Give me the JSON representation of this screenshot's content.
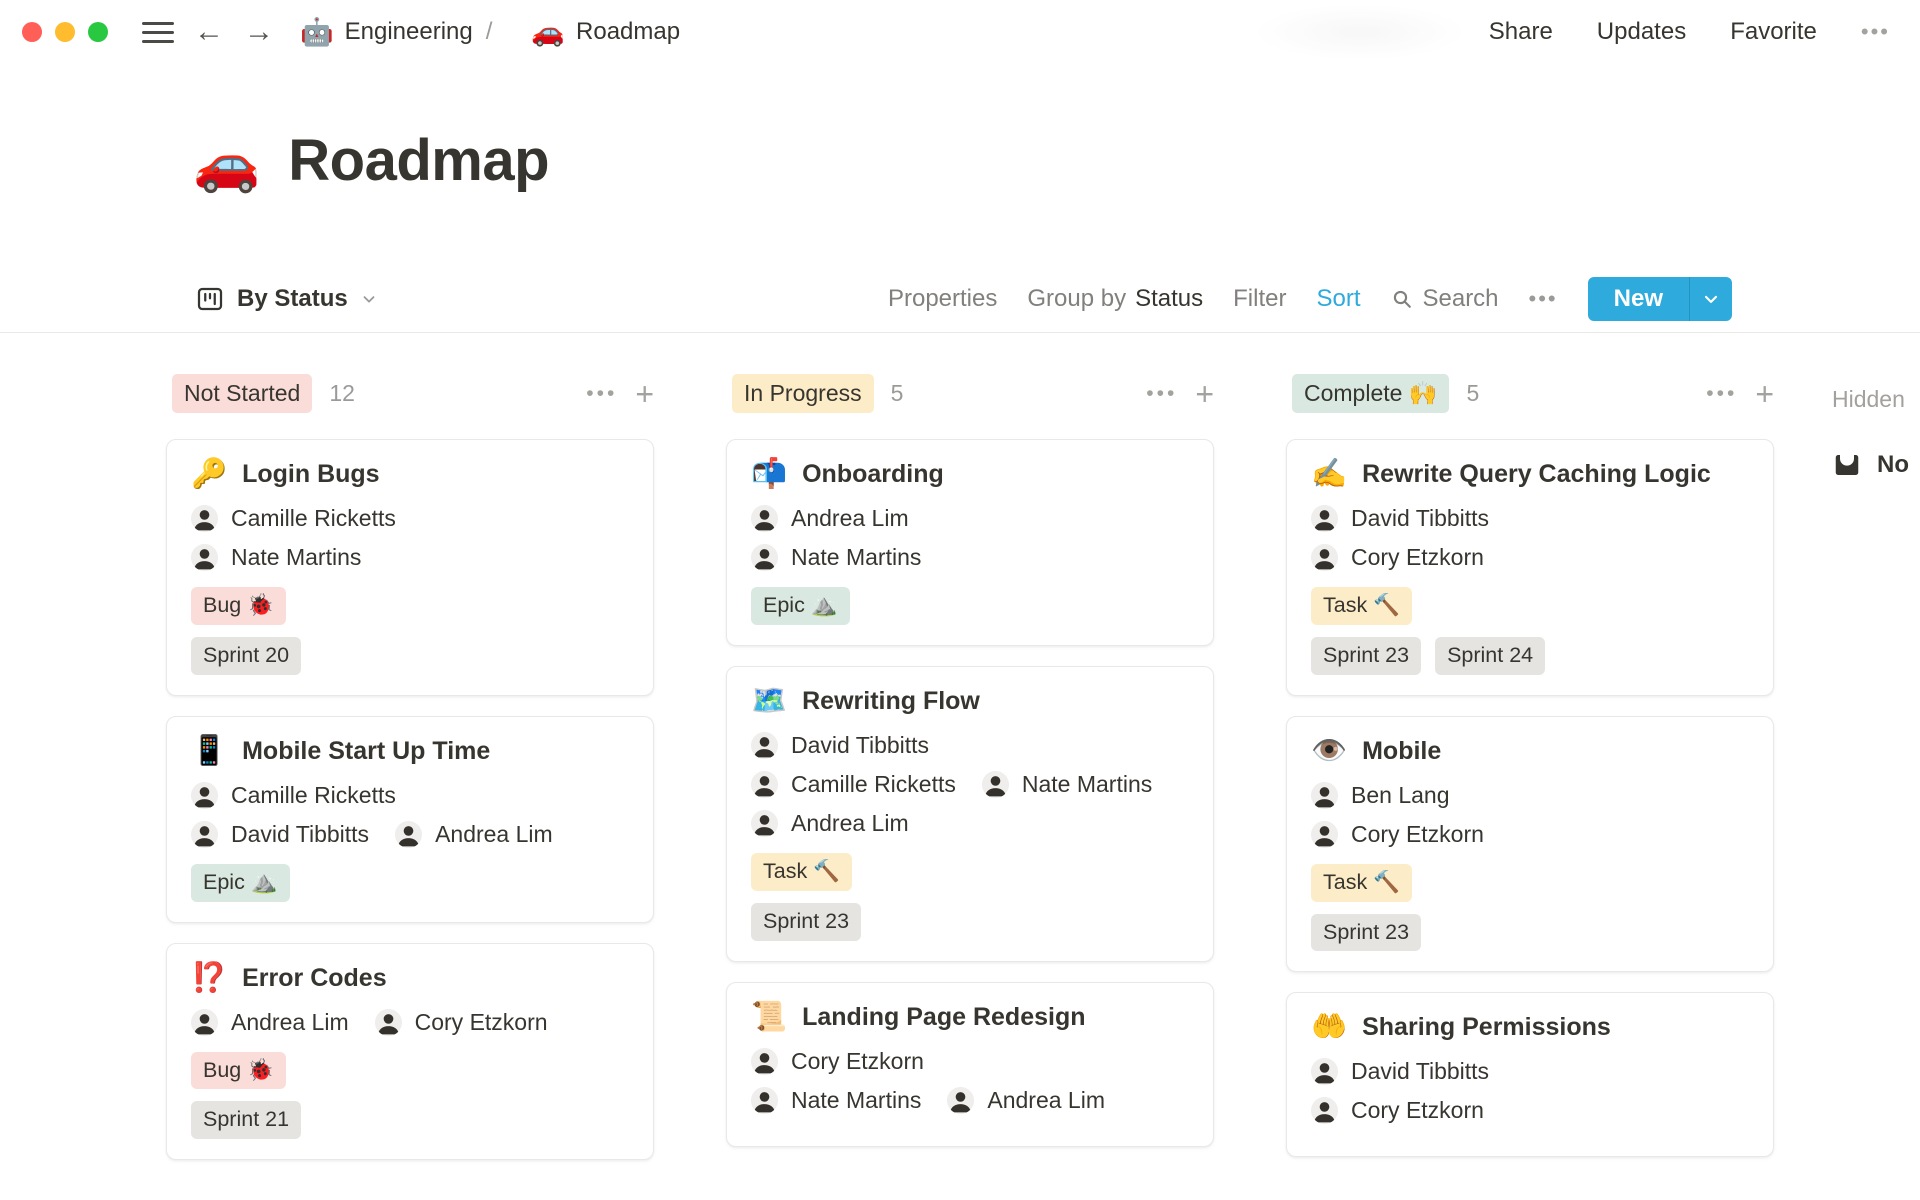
{
  "titlebar": {
    "back_icon": "←",
    "forward_icon": "→",
    "breadcrumb": {
      "separator": "/",
      "items": [
        {
          "icon": "🤖",
          "label": "Engineering"
        },
        {
          "icon": "🚗",
          "label": "Roadmap"
        }
      ]
    },
    "actions": [
      {
        "label": "Share"
      },
      {
        "label": "Updates"
      },
      {
        "label": "Favorite"
      },
      {
        "label": "•••"
      }
    ]
  },
  "page": {
    "icon": "🚗",
    "title": "Roadmap"
  },
  "toolbar": {
    "view_label": "By Status",
    "properties_label": "Properties",
    "group_by_label": "Group by",
    "group_by_value": "Status",
    "filter_label": "Filter",
    "sort_label": "Sort",
    "search_label": "Search",
    "more_label": "•••",
    "new_label": "New"
  },
  "colors": {
    "accent_blue": "#2EAADC",
    "pink": "#FADCD9",
    "yellow": "#FDECC8",
    "green": "#D9E8E0",
    "gray": "#E5E4E1",
    "traffic_red": "#FF5F57",
    "traffic_yellow": "#FEBC2E",
    "traffic_green": "#28C840"
  },
  "board": {
    "column_more": "•••",
    "column_add": "+",
    "hidden_label": "Hidden",
    "hidden_group": {
      "label": "No"
    },
    "columns": [
      {
        "name": "Not Started",
        "count": "12",
        "badge_color": "pink",
        "cards": [
          {
            "icon": "🔑",
            "icon_name": "key-icon",
            "title": "Login Bugs",
            "people": [
              [
                "Camille Ricketts"
              ],
              [
                "Nate Martins"
              ]
            ],
            "tag_rows": [
              [
                {
                  "label": "Bug 🐞",
                  "color": "pink"
                }
              ],
              [
                {
                  "label": "Sprint 20",
                  "color": "gray"
                }
              ]
            ]
          },
          {
            "icon": "📱",
            "icon_name": "mobile-phone-icon",
            "title": "Mobile Start Up Time",
            "people": [
              [
                "Camille Ricketts"
              ],
              [
                "David Tibbitts",
                "Andrea Lim"
              ]
            ],
            "tag_rows": [
              [
                {
                  "label": "Epic ⛰️",
                  "color": "green"
                }
              ]
            ]
          },
          {
            "icon": "⁉️",
            "icon_name": "exclamation-question-icon",
            "title": "Error Codes",
            "people": [
              [
                "Andrea Lim",
                "Cory Etzkorn"
              ]
            ],
            "tag_rows": [
              [
                {
                  "label": "Bug 🐞",
                  "color": "pink"
                }
              ],
              [
                {
                  "label": "Sprint 21",
                  "color": "gray"
                }
              ]
            ]
          }
        ]
      },
      {
        "name": "In Progress",
        "count": "5",
        "badge_color": "yellow",
        "cards": [
          {
            "icon": "📬",
            "icon_name": "mailbox-icon",
            "title": "Onboarding",
            "people": [
              [
                "Andrea Lim"
              ],
              [
                "Nate Martins"
              ]
            ],
            "tag_rows": [
              [
                {
                  "label": "Epic ⛰️",
                  "color": "green"
                }
              ]
            ]
          },
          {
            "icon": "🗺️",
            "icon_name": "world-map-icon",
            "title": "Rewriting Flow",
            "people": [
              [
                "David Tibbitts"
              ],
              [
                "Camille Ricketts",
                "Nate Martins"
              ],
              [
                "Andrea Lim"
              ]
            ],
            "tag_rows": [
              [
                {
                  "label": "Task 🔨",
                  "color": "yellow"
                }
              ],
              [
                {
                  "label": "Sprint 23",
                  "color": "gray"
                }
              ]
            ]
          },
          {
            "icon": "📜",
            "icon_name": "scroll-icon",
            "title": "Landing Page Redesign",
            "people": [
              [
                "Cory Etzkorn"
              ],
              [
                "Nate Martins",
                "Andrea Lim"
              ]
            ],
            "tag_rows": []
          }
        ]
      },
      {
        "name": "Complete 🙌",
        "count": "5",
        "badge_color": "green",
        "cards": [
          {
            "icon": "✍️",
            "icon_name": "writing-hand-icon",
            "title": "Rewrite Query Caching Logic",
            "people": [
              [
                "David Tibbitts"
              ],
              [
                "Cory Etzkorn"
              ]
            ],
            "tag_rows": [
              [
                {
                  "label": "Task 🔨",
                  "color": "yellow"
                }
              ],
              [
                {
                  "label": "Sprint 23",
                  "color": "gray"
                },
                {
                  "label": "Sprint 24",
                  "color": "gray"
                }
              ]
            ]
          },
          {
            "icon": "👁️",
            "icon_name": "eye-icon",
            "title": "Mobile",
            "people": [
              [
                "Ben Lang"
              ],
              [
                "Cory Etzkorn"
              ]
            ],
            "tag_rows": [
              [
                {
                  "label": "Task 🔨",
                  "color": "yellow"
                }
              ],
              [
                {
                  "label": "Sprint 23",
                  "color": "gray"
                }
              ]
            ]
          },
          {
            "icon": "🤲",
            "icon_name": "open-hands-icon",
            "title": "Sharing Permissions",
            "people": [
              [
                "David Tibbitts"
              ],
              [
                "Cory Etzkorn"
              ]
            ],
            "tag_rows": []
          }
        ]
      }
    ]
  }
}
